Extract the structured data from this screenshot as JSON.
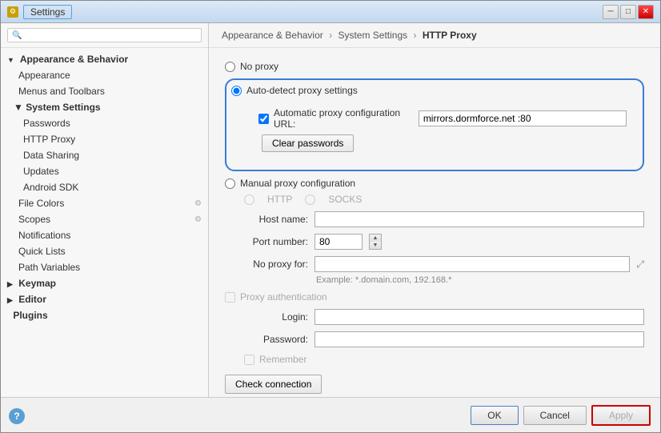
{
  "window": {
    "title": "Settings",
    "close_btn": "✕",
    "min_btn": "─",
    "max_btn": "□"
  },
  "search": {
    "placeholder": ""
  },
  "sidebar": {
    "sections": [
      {
        "id": "appearance-behavior",
        "label": "Appearance & Behavior",
        "expanded": true,
        "children": [
          {
            "id": "appearance",
            "label": "Appearance",
            "selected": false,
            "indent": 1
          },
          {
            "id": "menus-toolbars",
            "label": "Menus and Toolbars",
            "selected": false,
            "indent": 1
          },
          {
            "id": "system-settings",
            "label": "System Settings",
            "expanded": true,
            "indent": 1,
            "children": [
              {
                "id": "passwords",
                "label": "Passwords",
                "selected": false,
                "indent": 2
              },
              {
                "id": "http-proxy",
                "label": "HTTP Proxy",
                "selected": true,
                "indent": 2
              },
              {
                "id": "data-sharing",
                "label": "Data Sharing",
                "selected": false,
                "indent": 2
              },
              {
                "id": "updates",
                "label": "Updates",
                "selected": false,
                "indent": 2
              },
              {
                "id": "android-sdk",
                "label": "Android SDK",
                "selected": false,
                "indent": 2
              }
            ]
          },
          {
            "id": "file-colors",
            "label": "File Colors",
            "selected": false,
            "indent": 1,
            "has_icon": true
          },
          {
            "id": "scopes",
            "label": "Scopes",
            "selected": false,
            "indent": 1,
            "has_icon": true
          },
          {
            "id": "notifications",
            "label": "Notifications",
            "selected": false,
            "indent": 1
          },
          {
            "id": "quick-lists",
            "label": "Quick Lists",
            "selected": false,
            "indent": 1
          },
          {
            "id": "path-variables",
            "label": "Path Variables",
            "selected": false,
            "indent": 1
          }
        ]
      },
      {
        "id": "keymap",
        "label": "Keymap",
        "expanded": false
      },
      {
        "id": "editor",
        "label": "Editor",
        "expanded": false
      },
      {
        "id": "plugins",
        "label": "Plugins",
        "expanded": false
      }
    ]
  },
  "breadcrumb": {
    "parts": [
      "Appearance & Behavior",
      "System Settings",
      "HTTP Proxy"
    ]
  },
  "main": {
    "no_proxy_label": "No proxy",
    "auto_detect_label": "Auto-detect proxy settings",
    "auto_config_checkbox_label": "Automatic proxy configuration URL:",
    "proxy_url_value": "mirrors.dormforce.net :80",
    "clear_passwords_btn": "Clear passwords",
    "manual_proxy_label": "Manual proxy configuration",
    "http_label": "HTTP",
    "socks_label": "SOCKS",
    "host_name_label": "Host name:",
    "port_number_label": "Port number:",
    "port_value": "80",
    "no_proxy_for_label": "No proxy for:",
    "example_text": "Example: *.domain.com, 192.168.*",
    "proxy_auth_checkbox_label": "Proxy authentication",
    "login_label": "Login:",
    "password_label": "Password:",
    "remember_label": "Remember",
    "check_connection_btn": "Check connection"
  },
  "footer": {
    "ok_label": "OK",
    "cancel_label": "Cancel",
    "apply_label": "Apply",
    "help_label": "?"
  }
}
